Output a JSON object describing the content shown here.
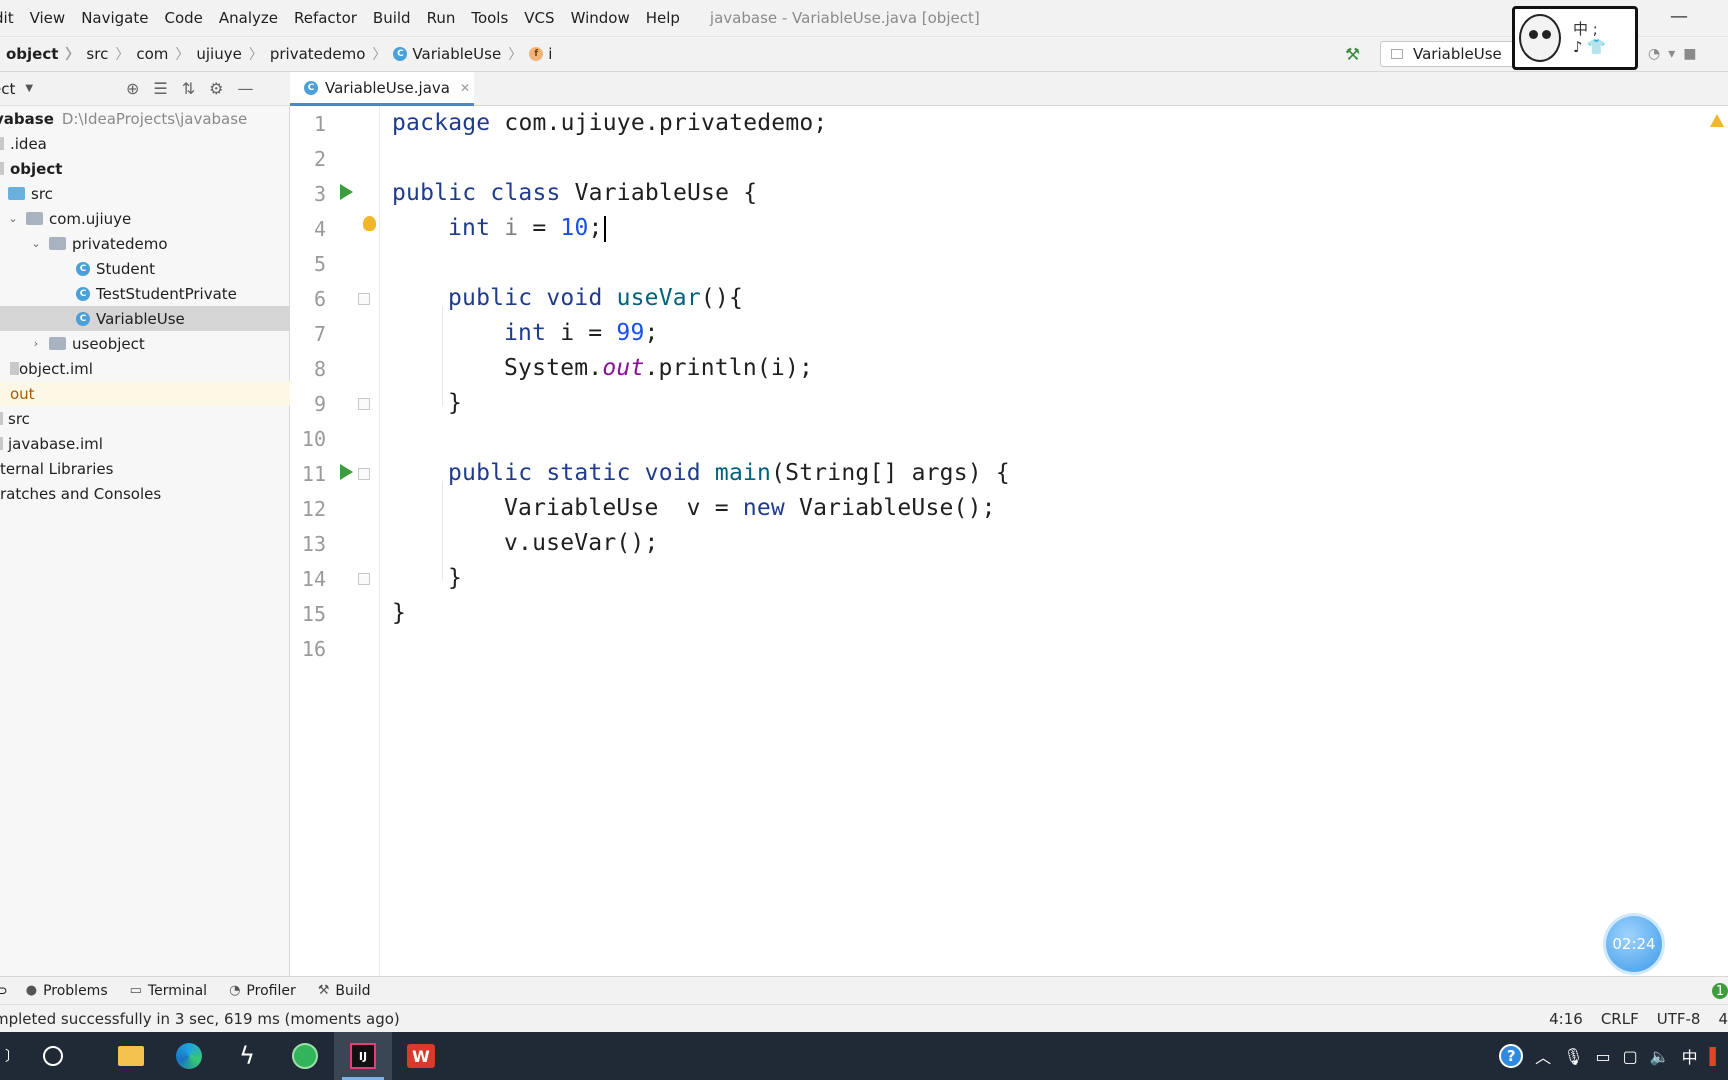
{
  "menu": {
    "items": [
      "dit",
      "View",
      "Navigate",
      "Code",
      "Analyze",
      "Refactor",
      "Build",
      "Run",
      "Tools",
      "VCS",
      "Window",
      "Help"
    ],
    "window_title": "javabase - VariableUse.java [object]"
  },
  "breadcrumb": {
    "items": [
      "object",
      "src",
      "com",
      "ujiuye",
      "privatedemo",
      "VariableUse",
      "i"
    ],
    "run_config": "VariableUse",
    "sticker_text_1": "中 ;",
    "sticker_text_2": "♪ 👕"
  },
  "project": {
    "header_title": "ect",
    "tree": [
      {
        "label": "vabase",
        "path": "D:\\IdeaProjects\\javabase",
        "kind": "root"
      },
      {
        "label": ".idea",
        "kind": "folder"
      },
      {
        "label": "object",
        "kind": "module"
      },
      {
        "label": "src",
        "kind": "src-folder"
      },
      {
        "label": "com.ujiuye",
        "kind": "package",
        "arrow": "expanded"
      },
      {
        "label": "privatedemo",
        "kind": "package",
        "arrow": "expanded"
      },
      {
        "label": "Student",
        "kind": "class"
      },
      {
        "label": "TestStudentPrivate",
        "kind": "class"
      },
      {
        "label": "VariableUse",
        "kind": "class",
        "selected": true
      },
      {
        "label": "useobject",
        "kind": "package",
        "arrow": "collapsed"
      },
      {
        "label": "object.iml",
        "kind": "file"
      },
      {
        "label": "out",
        "kind": "excluded"
      },
      {
        "label": "src",
        "kind": "folder"
      },
      {
        "label": "javabase.iml",
        "kind": "file"
      },
      {
        "label": "ternal Libraries",
        "kind": "lib"
      },
      {
        "label": "ratches and Consoles",
        "kind": "lib"
      }
    ]
  },
  "editor": {
    "tab_label": "VariableUse.java",
    "line_numbers": [
      "1",
      "2",
      "3",
      "4",
      "5",
      "6",
      "7",
      "8",
      "9",
      "10",
      "11",
      "12",
      "13",
      "14",
      "15",
      "16"
    ],
    "code": {
      "l1_kw": "package",
      "l1_rest": " com.ujiuye.privatedemo;",
      "l3_kw": "public class",
      "l3_rest": " VariableUse {",
      "l4_kw": "int",
      "l4_var": " i",
      "l4_eq": " = ",
      "l4_num": "10",
      "l4_end": ";",
      "l6_kw": "public void",
      "l6_fn": " useVar",
      "l6_rest": "(){",
      "l7_kw": "int",
      "l7_mid": " i = ",
      "l7_num": "99",
      "l7_end": ";",
      "l8_a": "System.",
      "l8_st": "out",
      "l8_b": ".println(i);",
      "l9": "}",
      "l11_kw": "public static void",
      "l11_fn": " main",
      "l11_rest": "(String[] args) {",
      "l12_a": "VariableUse  v = ",
      "l12_kw": "new",
      "l12_b": " VariableUse();",
      "l13": "v.useVar();",
      "l14": "}",
      "l15": "}"
    },
    "timer": "02:24"
  },
  "tool_windows": {
    "items": [
      "Problems",
      "Terminal",
      "Profiler",
      "Build"
    ],
    "left_stub": "",
    "right_badge": "1"
  },
  "status": {
    "message": "mpleted successfully in 3 sec, 619 ms (moments ago)",
    "position": "4:16",
    "line_sep": "CRLF",
    "encoding": "UTF-8",
    "indent": "4"
  },
  "taskbar": {
    "idea_label": "IJ",
    "wps_label": "W",
    "ime": "中"
  }
}
